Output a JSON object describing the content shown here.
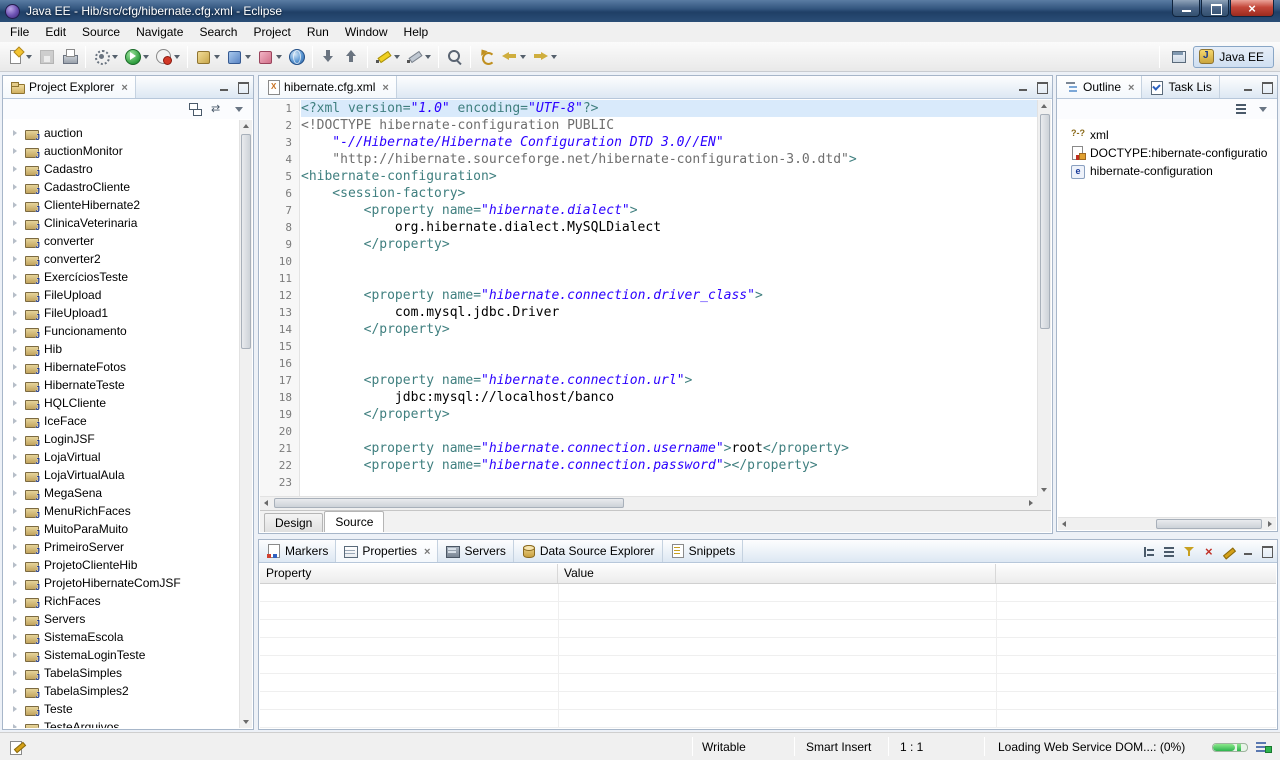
{
  "window": {
    "title": "Java EE - Hib/src/cfg/hibernate.cfg.xml - Eclipse",
    "perspective_label": "Java EE"
  },
  "menu": {
    "items": [
      "File",
      "Edit",
      "Source",
      "Navigate",
      "Search",
      "Project",
      "Run",
      "Window",
      "Help"
    ]
  },
  "toolbar": {
    "buttons": [
      {
        "name": "new",
        "icon": "new",
        "dropdown": true
      },
      {
        "name": "save",
        "icon": "save",
        "disabled": true
      },
      {
        "name": "print",
        "icon": "print"
      },
      {
        "sep": true
      },
      {
        "name": "external-tools",
        "icon": "tools",
        "dropdown": true
      },
      {
        "name": "run",
        "icon": "run",
        "dropdown": true
      },
      {
        "name": "coverage",
        "icon": "coverage",
        "dropdown": true
      },
      {
        "sep": true
      },
      {
        "name": "new-java-ee-project",
        "icon": "cube-gold",
        "dropdown": true
      },
      {
        "name": "new-servlet",
        "icon": "cube-blue",
        "dropdown": true
      },
      {
        "name": "new-web-page",
        "icon": "cube-pink",
        "dropdown": true
      },
      {
        "name": "open-web-browser",
        "icon": "globe"
      },
      {
        "sep": true
      },
      {
        "name": "next-annotation",
        "icon": "arr-down"
      },
      {
        "name": "previous-annotation",
        "icon": "arr-up"
      },
      {
        "sep": true
      },
      {
        "name": "mark-occurrences",
        "icon": "pen-yellow",
        "dropdown": true
      },
      {
        "name": "format",
        "icon": "pen-gray",
        "dropdown": true
      },
      {
        "sep": true
      },
      {
        "name": "search",
        "icon": "search"
      },
      {
        "sep": true
      },
      {
        "name": "last-edit-location",
        "icon": "undo-gold"
      },
      {
        "name": "back",
        "icon": "nav-back",
        "dropdown": true
      },
      {
        "name": "forward",
        "icon": "nav-forward",
        "dropdown": true
      }
    ]
  },
  "project_explorer": {
    "title": "Project Explorer",
    "projects": [
      "auction",
      "auctionMonitor",
      "Cadastro",
      "CadastroCliente",
      "ClienteHibernate2",
      "ClinicaVeterinaria",
      "converter",
      "converter2",
      "ExercíciosTeste",
      "FileUpload",
      "FileUpload1",
      "Funcionamento",
      "Hib",
      "HibernateFotos",
      "HibernateTeste",
      "HQLCliente",
      "IceFace",
      "LoginJSF",
      "LojaVirtual",
      "LojaVirtualAula",
      "MegaSena",
      "MenuRichFaces",
      "MuitoParaMuito",
      "PrimeiroServer",
      "ProjetoClienteHib",
      "ProjetoHibernateComJSF",
      "RichFaces",
      "Servers",
      "SistemaEscola",
      "SistemaLoginTeste",
      "TabelaSimples",
      "TabelaSimples2",
      "Teste",
      "TesteArquivos"
    ]
  },
  "editor": {
    "tab_label": "hibernate.cfg.xml",
    "bottom_tabs": [
      "Design",
      "Source"
    ],
    "active_bottom_tab": "Source",
    "lines": [
      {
        "n": "1",
        "hl": true,
        "segs": [
          [
            "t",
            "<?xml "
          ],
          [
            "t",
            "version="
          ],
          [
            "v",
            "\"1.0\""
          ],
          [
            "t",
            " encoding="
          ],
          [
            "v",
            "\"UTF-8\""
          ],
          [
            "t",
            "?>"
          ]
        ]
      },
      {
        "n": "2",
        "segs": [
          [
            "d",
            "<!DOCTYPE hibernate-configuration PUBLIC"
          ]
        ]
      },
      {
        "n": "3",
        "segs": [
          [
            "v",
            "    \"-//Hibernate/Hibernate Configuration DTD 3.0//EN\""
          ]
        ]
      },
      {
        "n": "4",
        "segs": [
          [
            "d",
            "    \"http://hibernate.sourceforge.net/hibernate-configuration-3.0.dtd\""
          ],
          [
            "t",
            ">"
          ]
        ]
      },
      {
        "n": "5",
        "segs": [
          [
            "t",
            "<hibernate-configuration>"
          ]
        ]
      },
      {
        "n": "6",
        "segs": [
          [
            "t",
            "    <session-factory>"
          ]
        ]
      },
      {
        "n": "7",
        "segs": [
          [
            "t",
            "        <property "
          ],
          [
            "t",
            "name="
          ],
          [
            "v",
            "\"hibernate.dialect\""
          ],
          [
            "t",
            ">"
          ]
        ]
      },
      {
        "n": "8",
        "segs": [
          [
            "x",
            "            org.hibernate.dialect.MySQLDialect"
          ]
        ]
      },
      {
        "n": "9",
        "segs": [
          [
            "t",
            "        </property>"
          ]
        ]
      },
      {
        "n": "10",
        "segs": []
      },
      {
        "n": "11",
        "segs": []
      },
      {
        "n": "12",
        "segs": [
          [
            "t",
            "        <property "
          ],
          [
            "t",
            "name="
          ],
          [
            "v",
            "\"hibernate.connection.driver_class\""
          ],
          [
            "t",
            ">"
          ]
        ]
      },
      {
        "n": "13",
        "segs": [
          [
            "x",
            "            com.mysql.jdbc.Driver"
          ]
        ]
      },
      {
        "n": "14",
        "segs": [
          [
            "t",
            "        </property>"
          ]
        ]
      },
      {
        "n": "15",
        "segs": []
      },
      {
        "n": "16",
        "segs": []
      },
      {
        "n": "17",
        "segs": [
          [
            "t",
            "        <property "
          ],
          [
            "t",
            "name="
          ],
          [
            "v",
            "\"hibernate.connection.url\""
          ],
          [
            "t",
            ">"
          ]
        ]
      },
      {
        "n": "18",
        "segs": [
          [
            "x",
            "            jdbc:mysql://localhost/banco"
          ]
        ]
      },
      {
        "n": "19",
        "segs": [
          [
            "t",
            "        </property>"
          ]
        ]
      },
      {
        "n": "20",
        "segs": []
      },
      {
        "n": "21",
        "segs": [
          [
            "t",
            "        <property "
          ],
          [
            "t",
            "name="
          ],
          [
            "v",
            "\"hibernate.connection.username\""
          ],
          [
            "t",
            ">"
          ],
          [
            "x",
            "root"
          ],
          [
            "t",
            "</property>"
          ]
        ]
      },
      {
        "n": "22",
        "segs": [
          [
            "t",
            "        <property "
          ],
          [
            "t",
            "name="
          ],
          [
            "v",
            "\"hibernate.connection.password\""
          ],
          [
            "t",
            ">"
          ],
          [
            "t",
            "</property>"
          ]
        ]
      },
      {
        "n": "23",
        "segs": []
      }
    ]
  },
  "outline": {
    "active": "Outline",
    "tabs": [
      {
        "label": "Outline",
        "icon": "outline"
      },
      {
        "label": "Task Lis",
        "icon": "task-list"
      }
    ],
    "items": [
      {
        "icon": "xml-decl",
        "label": "xml"
      },
      {
        "icon": "doctype",
        "label": "DOCTYPE:hibernate-configuratio"
      },
      {
        "icon": "element",
        "label": "hibernate-configuration"
      }
    ]
  },
  "bottom_panel": {
    "active": "Properties",
    "tabs": [
      {
        "label": "Markers",
        "icon": "markers"
      },
      {
        "label": "Properties",
        "icon": "properties"
      },
      {
        "label": "Servers",
        "icon": "servers"
      },
      {
        "label": "Data Source Explorer",
        "icon": "data-source"
      },
      {
        "label": "Snippets",
        "icon": "snippets"
      }
    ],
    "columns": [
      "Property",
      "Value"
    ],
    "empty_row_count": 8
  },
  "status_bar": {
    "writable": "Writable",
    "insert_mode": "Smart Insert",
    "caret_position": "1 : 1",
    "progress_text": "Loading Web Service DOM...: (0%)"
  }
}
